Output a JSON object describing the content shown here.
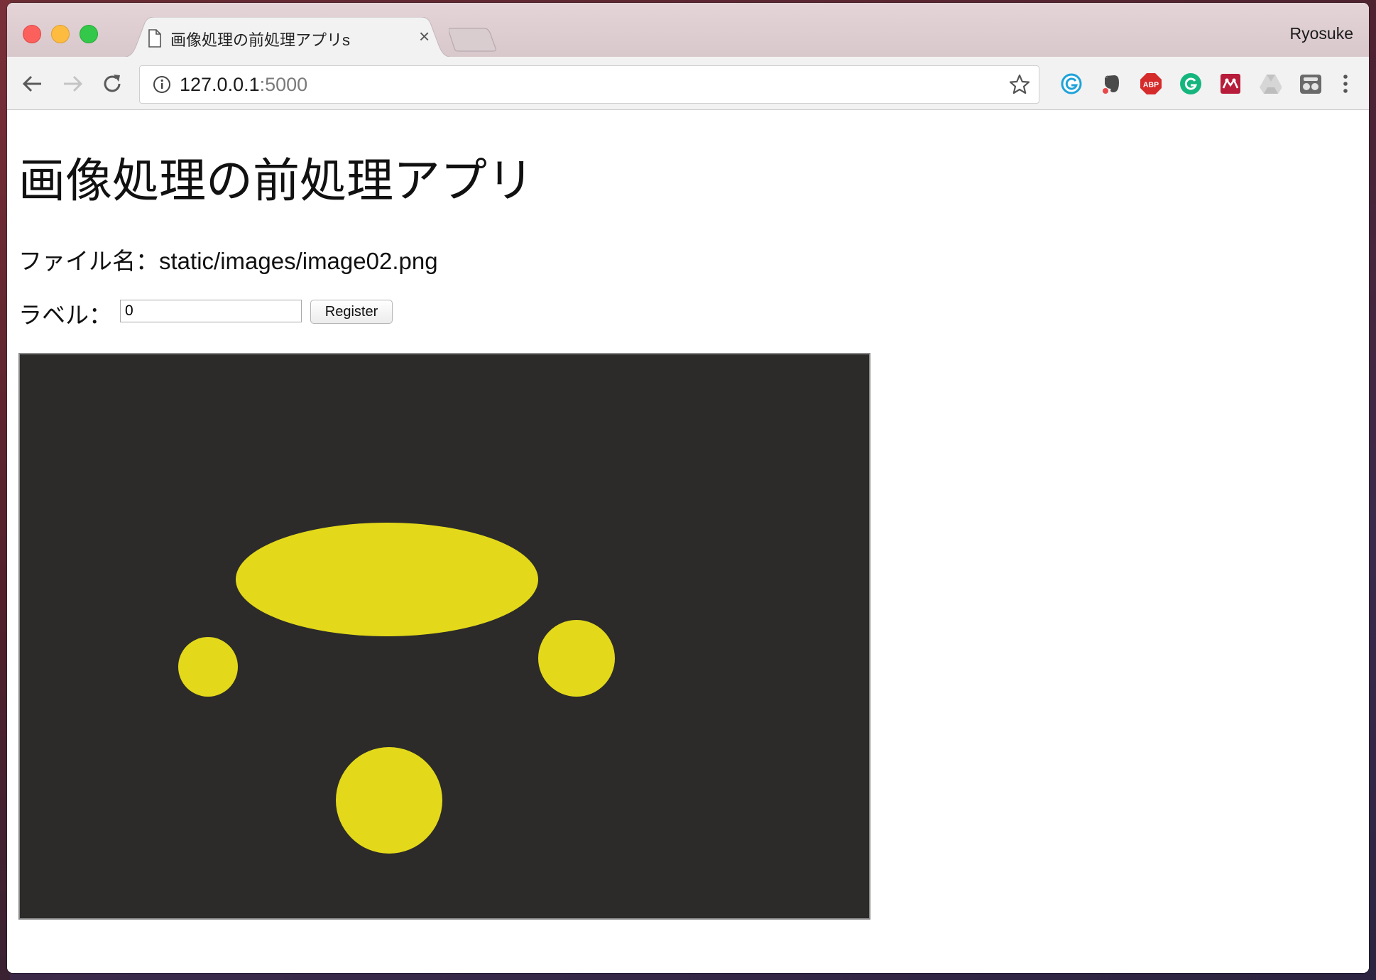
{
  "browser": {
    "tab_title": "画像処理の前処理アプリs",
    "tab_close": "×",
    "profile_name": "Ryosuke",
    "url_host": "127.0.0.1",
    "url_port": ":5000"
  },
  "extensions": [
    "grammarly-icon",
    "evernote-icon",
    "adblock-plus-icon",
    "grammarly-green-icon",
    "mendeley-icon",
    "google-drive-icon",
    "incognito-extension-icon"
  ],
  "page": {
    "title": "画像処理の前処理アプリ",
    "file_label": "ファイル名：static/images/image02.png",
    "label_caption": "ラベル：",
    "label_value": "0",
    "register_button": "Register"
  },
  "image": {
    "background_color": "#2c2b29",
    "shape_color": "#e3d91a",
    "shapes": [
      "ellipse",
      "circle",
      "circle",
      "circle"
    ]
  }
}
